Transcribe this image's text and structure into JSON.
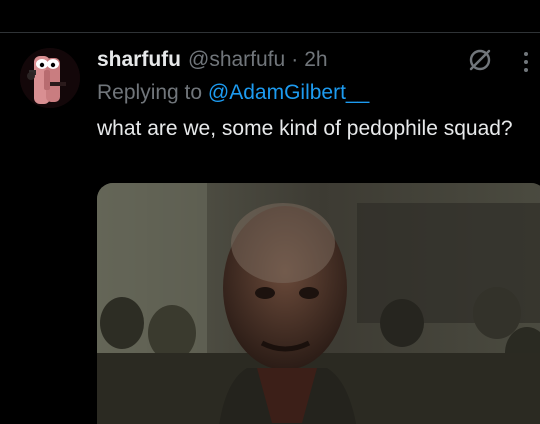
{
  "tweet": {
    "display_name": "sharfufu",
    "handle": "@sharfufu",
    "separator": "·",
    "time": "2h",
    "replying_prefix": "Replying to",
    "replying_to": "@AdamGilbert__",
    "text": "what are we, some kind of pedophile squad?"
  },
  "icons": {
    "grok": "grok-icon",
    "more": "more-options-icon"
  },
  "colors": {
    "background": "#000000",
    "primary_text": "#e7e9ea",
    "secondary_text": "#71767b",
    "link": "#1d9bf0",
    "divider": "#2f3336"
  }
}
